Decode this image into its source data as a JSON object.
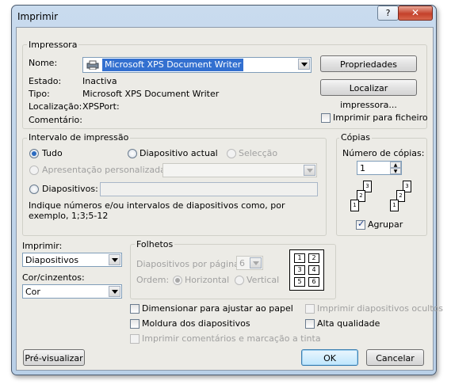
{
  "dialog": {
    "title": "Imprimir",
    "help": "?",
    "close": "✕"
  },
  "printer": {
    "legend": "Impressora",
    "name_label": "Nome:",
    "name_value": "Microsoft XPS Document Writer",
    "status_label": "Estado:",
    "status_value": "Inactiva",
    "type_label": "Tipo:",
    "type_value": "Microsoft XPS Document Writer",
    "location_label": "Localização:",
    "location_value": "XPSPort:",
    "comment_label": "Comentário:",
    "properties_button": "Propriedades",
    "find_printer_button": "Localizar impressora...",
    "print_to_file": "Imprimir para ficheiro"
  },
  "range": {
    "legend": "Intervalo de impressão",
    "all": "Tudo",
    "current_slide": "Diapositivo actual",
    "selection": "Selecção",
    "custom_show": "Apresentação personalizada:",
    "slides": "Diapositivos:",
    "hint": "Indique números e/ou intervalos de diapositivos como, por exemplo, 1;3;5-12"
  },
  "copies": {
    "legend": "Cópias",
    "count_label": "Número de cópias:",
    "count_value": "1",
    "collate": "Agrupar",
    "collate_checked": true,
    "stack1": [
      "1",
      "2",
      "3"
    ],
    "stack2": [
      "1",
      "2",
      "3"
    ]
  },
  "print_what": {
    "label": "Imprimir:",
    "value": "Diapositivos",
    "color_label": "Cor/cinzentos:",
    "color_value": "Cor"
  },
  "handouts": {
    "legend": "Folhetos",
    "per_page_label": "Diapositivos por página:",
    "per_page_value": "6",
    "order_label": "Ordem:",
    "horizontal": "Horizontal",
    "vertical": "Vertical",
    "preview_numbers": [
      "1",
      "2",
      "3",
      "4",
      "5",
      "6"
    ]
  },
  "options": {
    "scale_to_fit": "Dimensionar para ajustar ao papel",
    "frame_slides": "Moldura dos diapositivos",
    "print_comments": "Imprimir comentários e marcação a tinta",
    "print_hidden": "Imprimir diapositivos ocultos",
    "high_quality": "Alta qualidade"
  },
  "footer": {
    "preview_button": "Pré-visualizar",
    "ok_button": "OK",
    "cancel_button": "Cancelar"
  }
}
